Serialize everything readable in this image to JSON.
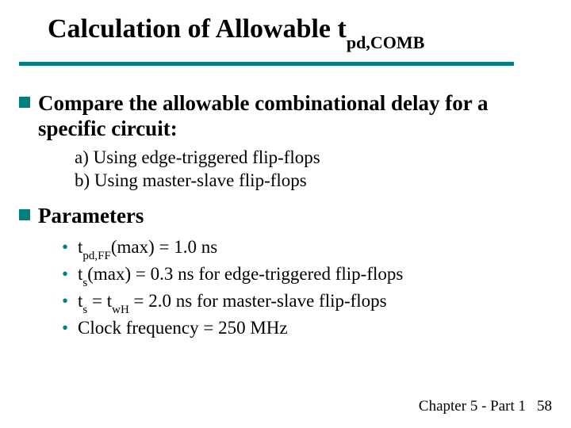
{
  "title": {
    "main_pre": "Calculation of Allowable t",
    "main_sub": "pd,COMB"
  },
  "bullets": {
    "b1_line1": "Compare the allowable combinational delay for a",
    "b1_line2": "specific circuit:",
    "b1_sub_a": "a) Using edge-triggered flip-flops",
    "b1_sub_b": "b) Using master-slave flip-flops",
    "b2": "Parameters",
    "p1_pre": "t",
    "p1_sub": "pd,FF",
    "p1_post": "(max) = 1.0 ns",
    "p2_pre": "t",
    "p2_sub": "s",
    "p2_post": "(max) = 0.3 ns for edge-triggered flip-flops",
    "p3_pre1": "t",
    "p3_sub1": "s",
    "p3_mid": " = t",
    "p3_sub2": "wH",
    "p3_post": " = 2.0 ns for master-slave flip-flops",
    "p4": "Clock frequency = 250 MHz"
  },
  "footer": {
    "chapter": "Chapter 5 - Part 1",
    "page": "58"
  }
}
